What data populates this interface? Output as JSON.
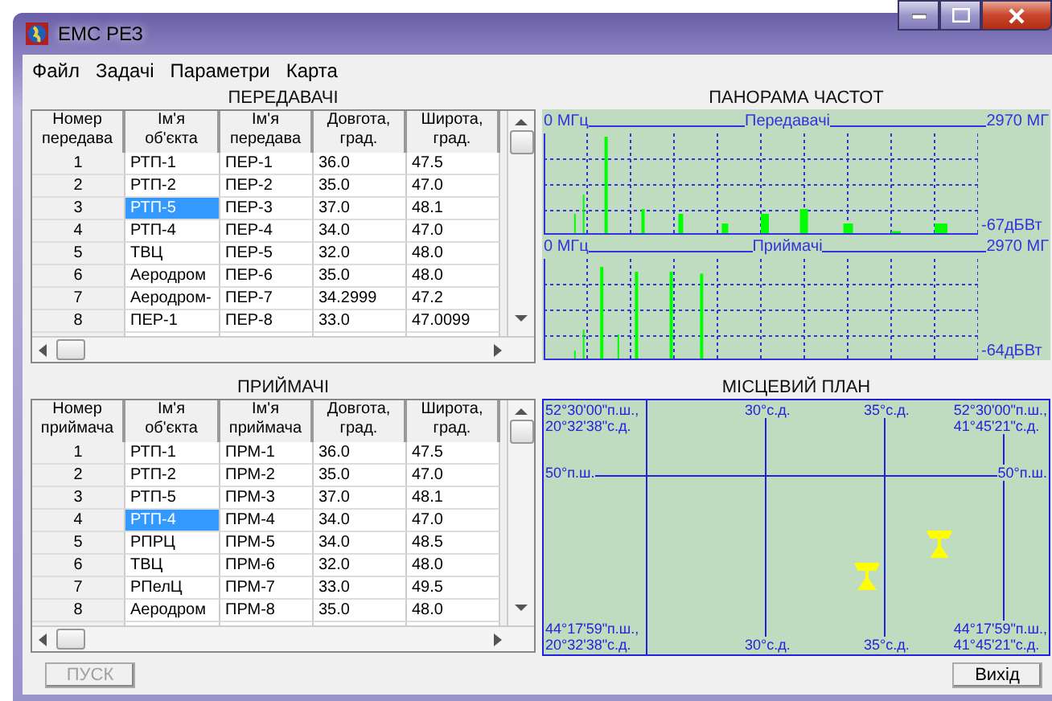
{
  "window": {
    "title": "ЕМС РЕЗ"
  },
  "menu": [
    "Файл",
    "Задачі",
    "Параметри",
    "Карта"
  ],
  "transmitters": {
    "title": "ПЕРЕДАВАЧІ",
    "columns": [
      "Номер\nпередава",
      "Ім'я\nоб'єкта",
      "Ім'я\nпередава",
      "Довгота,\nград.",
      "Широта,\nград."
    ],
    "rows": [
      {
        "cells": [
          "1",
          "РТП-1",
          "ПЕР-1",
          "36.0",
          "47.5"
        ],
        "selected": false
      },
      {
        "cells": [
          "2",
          "РТП-2",
          "ПЕР-2",
          "35.0",
          "47.0"
        ],
        "selected": false
      },
      {
        "cells": [
          "3",
          "РТП-5",
          "ПЕР-3",
          "37.0",
          "48.1"
        ],
        "selected": true
      },
      {
        "cells": [
          "4",
          "РТП-4",
          "ПЕР-4",
          "34.0",
          "47.0"
        ],
        "selected": false
      },
      {
        "cells": [
          "5",
          "ТВЦ",
          "ПЕР-5",
          "32.0",
          "48.0"
        ],
        "selected": false
      },
      {
        "cells": [
          "6",
          "Аеродром",
          "ПЕР-6",
          "35.0",
          "48.0"
        ],
        "selected": false
      },
      {
        "cells": [
          "7",
          "Аеродром-",
          "ПЕР-7",
          "34.2999",
          "47.2"
        ],
        "selected": false
      },
      {
        "cells": [
          "8",
          "ПЕР-1",
          "ПЕР-8",
          "33.0",
          "47.0099"
        ],
        "selected": false
      }
    ]
  },
  "spectrum": {
    "title": "ПАНОРАМА ЧАСТОТ",
    "panels": [
      {
        "start": "0 МГц",
        "label": "Передавачі",
        "end": "2970 МГ",
        "floor": "-67дБВт"
      },
      {
        "start": "0 МГц",
        "label": "Приймачі",
        "end": "2970 МГ",
        "floor": "-64дБВт"
      }
    ]
  },
  "receivers": {
    "title": "ПРИЙМАЧІ",
    "columns": [
      "Номер\nприймача",
      "Ім'я\nоб'єкта",
      "Ім'я\nприймача",
      "Довгота,\nград.",
      "Широта,\nград."
    ],
    "rows": [
      {
        "cells": [
          "1",
          "РТП-1",
          "ПРМ-1",
          "36.0",
          "47.5"
        ],
        "selected": false
      },
      {
        "cells": [
          "2",
          "РТП-2",
          "ПРМ-2",
          "35.0",
          "47.0"
        ],
        "selected": false
      },
      {
        "cells": [
          "3",
          "РТП-5",
          "ПРМ-3",
          "37.0",
          "48.1"
        ],
        "selected": false
      },
      {
        "cells": [
          "4",
          "РТП-4",
          "ПРМ-4",
          "34.0",
          "47.0"
        ],
        "selected": true
      },
      {
        "cells": [
          "5",
          "РПРЦ",
          "ПРМ-5",
          "34.0",
          "48.5"
        ],
        "selected": false
      },
      {
        "cells": [
          "6",
          "ТВЦ",
          "ПРМ-6",
          "32.0",
          "48.0"
        ],
        "selected": false
      },
      {
        "cells": [
          "7",
          "РПелЦ",
          "ПРМ-7",
          "33.0",
          "49.5"
        ],
        "selected": false
      },
      {
        "cells": [
          "8",
          "Аеродром",
          "ПРМ-8",
          "35.0",
          "48.0"
        ],
        "selected": false
      }
    ]
  },
  "map": {
    "title": "МІСЦЕВИЙ ПЛАН",
    "top_labels": [
      "52°30'00\"п.ш.,\n20°32'38\"с.д.",
      "30°с.д.",
      "35°с.д.",
      "52°30'00\"п.ш.,\n41°45'21\"с.д."
    ],
    "middle_labels": [
      "50°п.ш.",
      "50°п.ш."
    ],
    "bottom_labels": [
      "44°17'59\"п.ш.,\n20°32'38\"с.д.",
      "30°с.д.",
      "35°с.д.",
      "44°17'59\"п.ш.,\n41°45'21\"с.д."
    ]
  },
  "buttons": [
    {
      "label": "ПУСК",
      "disabled": true
    },
    {
      "label": "Вихід",
      "disabled": false
    }
  ]
}
